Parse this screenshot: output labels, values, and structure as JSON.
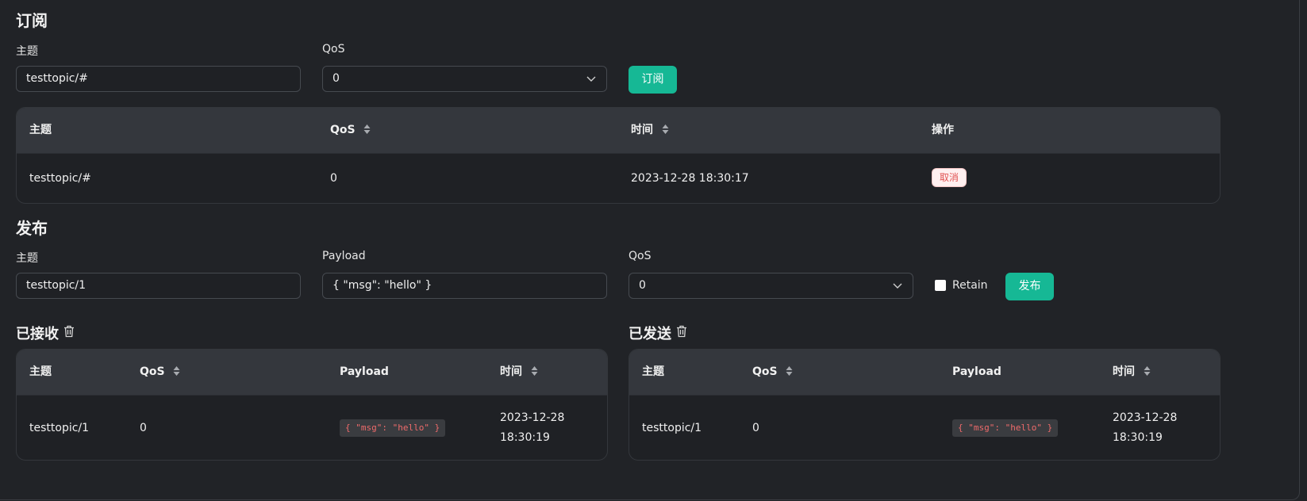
{
  "subscribe": {
    "title": "订阅",
    "topic_label": "主题",
    "topic_value": "testtopic/#",
    "qos_label": "QoS",
    "qos_value": "0",
    "button": "订阅",
    "table": {
      "headers": {
        "topic": "主题",
        "qos": "QoS",
        "time": "时间",
        "action": "操作"
      },
      "rows": [
        {
          "topic": "testtopic/#",
          "qos": "0",
          "time": "2023-12-28 18:30:17",
          "action": "取消"
        }
      ]
    }
  },
  "publish": {
    "title": "发布",
    "topic_label": "主题",
    "topic_value": "testtopic/1",
    "payload_label": "Payload",
    "payload_value": "{ \"msg\": \"hello\" }",
    "qos_label": "QoS",
    "qos_value": "0",
    "retain_label": "Retain",
    "button": "发布"
  },
  "received": {
    "title": "已接收",
    "headers": {
      "topic": "主题",
      "qos": "QoS",
      "payload": "Payload",
      "time": "时间"
    },
    "rows": [
      {
        "topic": "testtopic/1",
        "qos": "0",
        "payload": "{ \"msg\": \"hello\" }",
        "time_date": "2023-12-28",
        "time_clock": "18:30:19"
      }
    ]
  },
  "sent": {
    "title": "已发送",
    "headers": {
      "topic": "主题",
      "qos": "QoS",
      "payload": "Payload",
      "time": "时间"
    },
    "rows": [
      {
        "topic": "testtopic/1",
        "qos": "0",
        "payload": "{ \"msg\": \"hello\" }",
        "time_date": "2023-12-28",
        "time_clock": "18:30:19"
      }
    ]
  },
  "colors": {
    "accent": "#16b895",
    "background": "#212327",
    "header": "#34373d",
    "danger": "#e05353"
  },
  "icons": {
    "trash": "trash-icon",
    "chevron": "chevron-down-icon",
    "sort": "sort-icon"
  }
}
